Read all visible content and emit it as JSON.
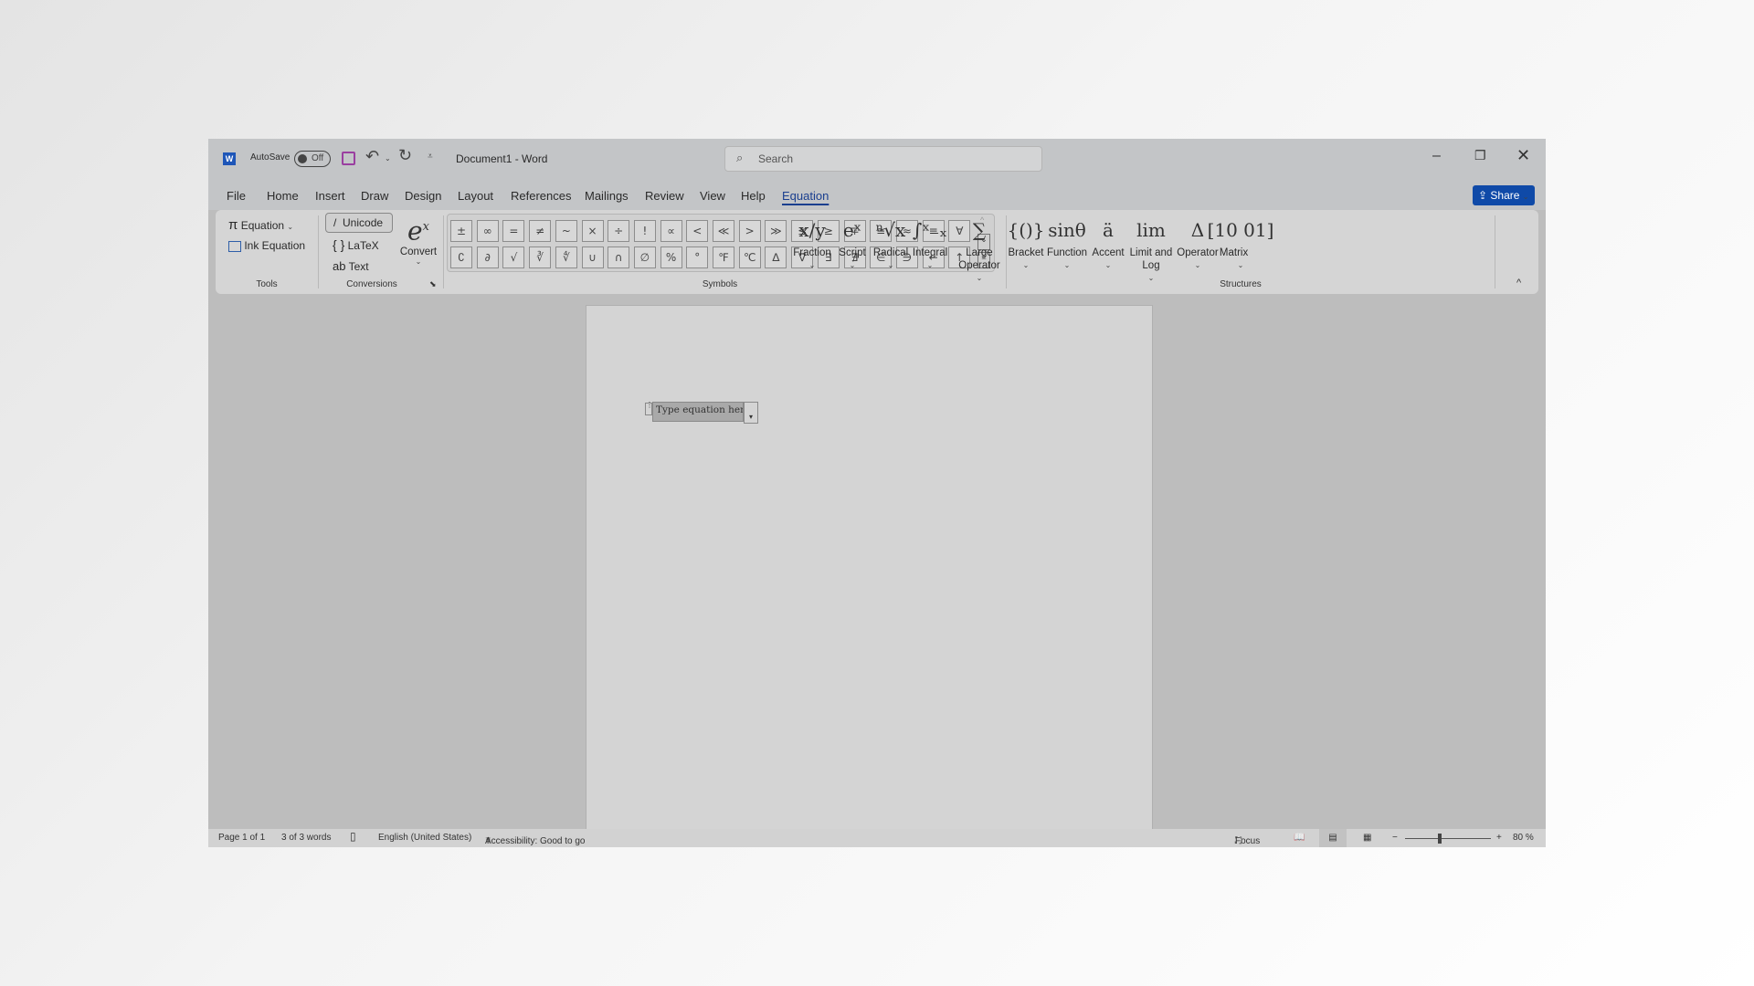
{
  "titlebar": {
    "autosave_label": "AutoSave",
    "toggle_state": "Off",
    "doc_title": "Document1  -  Word",
    "search_placeholder": "Search"
  },
  "tabs": [
    {
      "label": "File"
    },
    {
      "label": "Home"
    },
    {
      "label": "Insert"
    },
    {
      "label": "Draw"
    },
    {
      "label": "Design"
    },
    {
      "label": "Layout"
    },
    {
      "label": "References"
    },
    {
      "label": "Mailings"
    },
    {
      "label": "Review"
    },
    {
      "label": "View"
    },
    {
      "label": "Help"
    },
    {
      "label": "Equation",
      "active": true
    }
  ],
  "share_label": "Share",
  "tools": {
    "equation": "Equation",
    "ink_equation": "Ink Equation",
    "group": "Tools"
  },
  "conversions": {
    "unicode": "Unicode",
    "latex": "LaTeX",
    "text": "Text",
    "convert": "Convert",
    "group": "Conversions"
  },
  "symbols": {
    "group": "Symbols",
    "row1": [
      "±",
      "∞",
      "=",
      "≠",
      "~",
      "×",
      "÷",
      "!",
      "∝",
      "<",
      "≪",
      ">",
      "≫",
      "≤",
      "≥",
      "∓",
      "≅",
      "≈",
      "≡",
      "∀"
    ],
    "row2": [
      "∁",
      "∂",
      "√",
      "∛",
      "∜",
      "∪",
      "∩",
      "∅",
      "%",
      "°",
      "℉",
      "℃",
      "∆",
      "∇",
      "∃",
      "∄",
      "∈",
      "∋",
      "←",
      "↑"
    ]
  },
  "structures": {
    "group": "Structures",
    "items": [
      {
        "glyph": "x/y",
        "label": "Fraction"
      },
      {
        "glyph": "eˣ",
        "label": "Script"
      },
      {
        "glyph": "ⁿ√x",
        "label": "Radical"
      },
      {
        "glyph": "∫ˣ₋ₓ",
        "label": "Integral"
      },
      {
        "glyph": "∑",
        "label": "Large Operator"
      },
      {
        "glyph": "{()}",
        "label": "Bracket"
      },
      {
        "glyph": "sinθ",
        "label": "Function"
      },
      {
        "glyph": "ä",
        "label": "Accent"
      },
      {
        "glyph": "lim",
        "label": "Limit and Log"
      },
      {
        "glyph": "Δ",
        "label": "Operator"
      },
      {
        "glyph": "[10 01]",
        "label": "Matrix"
      }
    ]
  },
  "document": {
    "equation_placeholder": "Type equation here."
  },
  "status": {
    "page": "Page 1 of 1",
    "words": "3 of 3 words",
    "language": "English (United States)",
    "accessibility": "Accessibility: Good to go",
    "focus": "Focus",
    "zoom": "80 %",
    "zoom_percent": 80
  },
  "colors": {
    "accent": "#0f4aa8",
    "save_icon": "#9a3fa0"
  }
}
